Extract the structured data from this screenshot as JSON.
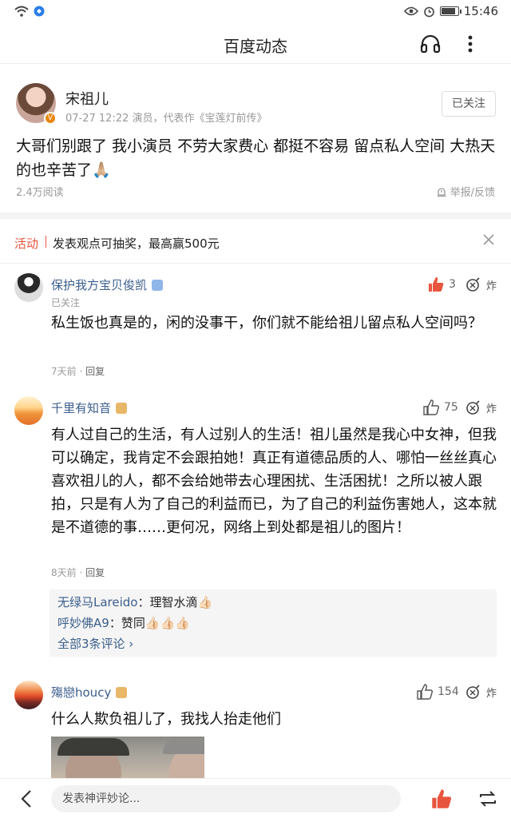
{
  "status_bar": {
    "time": "15:46"
  },
  "header": {
    "title": "百度动态",
    "icons": [
      "headphones-icon",
      "more-vertical-icon"
    ]
  },
  "post": {
    "author": "宋祖儿",
    "meta": "07-27 12:22  演员，代表作《宝莲灯前传》",
    "follow_label": "已关注",
    "text": "大哥们别跟了 我小演员 不劳大家费心 都挺不容易 留点私人空间 大热天的也辛苦了🙏🏼",
    "read_count": "2.4万阅读",
    "report_label": "举报/反馈"
  },
  "activity": {
    "tag": "活动",
    "text": "发表观点可抽奖，最高赢500元"
  },
  "comments": [
    {
      "name": "保护我方宝贝俊凯",
      "sub": "已关注",
      "likes": "3",
      "bomb": "炸",
      "text": "私生饭也真是的，闲的没事干，你们就不能给祖儿留点私人空间吗？",
      "time": "7天前",
      "reply_label": "回复"
    },
    {
      "name": "千里有知音",
      "likes": "75",
      "bomb": "炸",
      "text": "有人过自己的生活，有人过别人的生活！祖儿虽然是我心中女神，但我可以确定，我肯定不会跟拍她！真正有道德品质的人、哪怕一丝丝真心喜欢祖儿的人，都不会给她带去心理困扰、生活困扰！之所以被人跟拍，只是有人为了自己的利益而已，为了自己的利益伤害她人，这本就是不道德的事……更何况，网络上到处都是祖儿的图片！",
      "time": "8天前",
      "reply_label": "回复",
      "replies": [
        {
          "name": "无绿马Lareido",
          "text": "：理智水滴👍🏻"
        },
        {
          "name": "呼妙佛A9",
          "text": "：赞同👍🏻👍🏻👍🏻"
        }
      ],
      "all_replies": "全部3条评论 ›"
    },
    {
      "name": "殤戀houcy",
      "likes": "154",
      "bomb": "炸",
      "text": "什么人欺负祖儿了，我找人抬走他们"
    }
  ],
  "bottom_bar": {
    "input_placeholder": "发表神评妙论..."
  },
  "colors": {
    "accent_red": "#e8553e",
    "link_blue": "#3b5e8c",
    "like_active": "#e8553e"
  }
}
